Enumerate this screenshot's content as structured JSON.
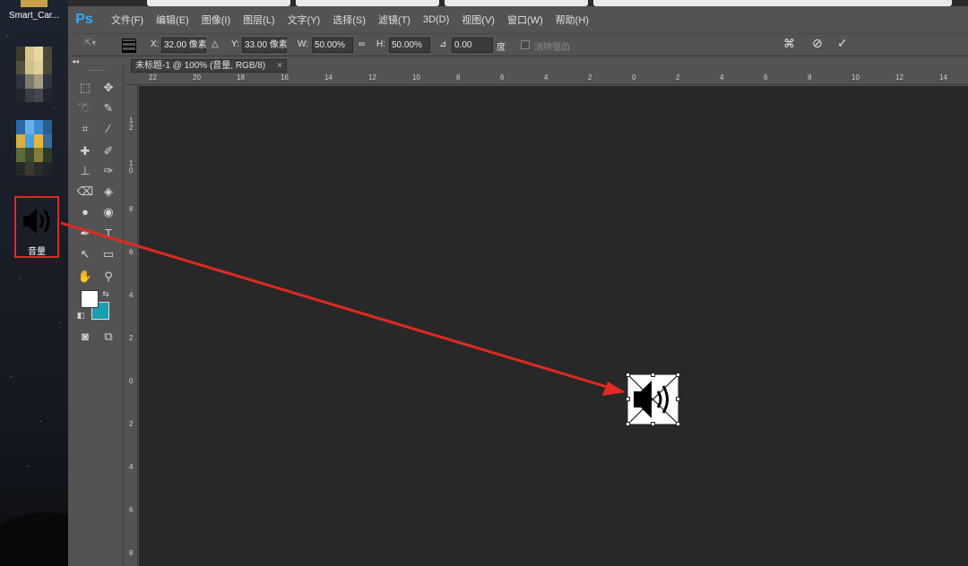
{
  "desktop": {
    "icons": [
      {
        "label": "Smart_Car..."
      },
      {
        "label": ""
      },
      {
        "label": ""
      },
      {
        "label": "音量"
      }
    ]
  },
  "app": {
    "logo": "Ps",
    "menu": [
      "文件(F)",
      "编辑(E)",
      "图像(I)",
      "图层(L)",
      "文字(Y)",
      "选择(S)",
      "滤镜(T)",
      "3D(D)",
      "视图(V)",
      "窗口(W)",
      "帮助(H)"
    ]
  },
  "options": {
    "x_label": "X:",
    "x_value": "32.00 像素",
    "y_label": "Y:",
    "y_value": "33.00 像素",
    "w_label": "W:",
    "w_value": "50.00%",
    "h_label": "H:",
    "h_value": "50.00%",
    "angle_value": "0.00",
    "angle_unit": "度",
    "interp_label": "消除锯齿"
  },
  "document": {
    "tab_title": "未标题-1 @ 100% (音量, RGB/8)",
    "tab_close": "×"
  },
  "rulers": {
    "top": [
      "22",
      "20",
      "18",
      "16",
      "14",
      "12",
      "10",
      "8",
      "6",
      "4",
      "2",
      "0",
      "2",
      "4",
      "6",
      "8",
      "10",
      "12",
      "14"
    ],
    "left": [
      "1 2",
      "1 0",
      "8",
      "6",
      "4",
      "2",
      "0",
      "2",
      "4",
      "6",
      "8"
    ]
  },
  "colors": {
    "accent": "#31a8ff",
    "background_swatch": "#1a9eb0",
    "foreground_swatch": "#ffffff",
    "annotation": "#e02a22"
  }
}
